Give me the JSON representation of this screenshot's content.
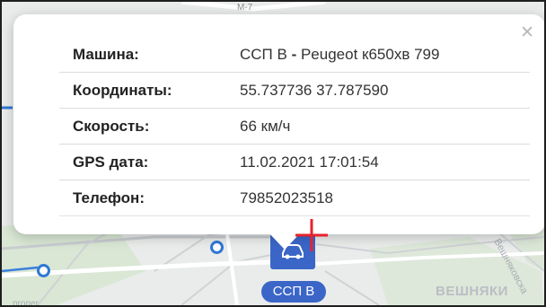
{
  "popup": {
    "close_icon": "close-icon",
    "rows": [
      {
        "label": "Машина:",
        "value_main": "ССП В",
        "value_sep": " - ",
        "value_rest": "Peugeot к650хв 799"
      },
      {
        "label": "Координаты:",
        "value": "55.737736 37.787590"
      },
      {
        "label": "Скорость:",
        "value": "66 км/ч"
      },
      {
        "label": "GPS дата:",
        "value": "11.02.2021 17:01:54"
      },
      {
        "label": "Телефон:",
        "value": "79852023518"
      }
    ]
  },
  "map": {
    "vehicle_label": "ССП В",
    "vehicle_icon": "car-icon",
    "district_label": "ВЕШНЯКИ",
    "street_label": "Вешняковска",
    "top_road_label": "M-7",
    "edge_label": "proper",
    "marker_color": "#3b66c8",
    "metro_color": "#2f78d6",
    "cross_color": "#e8222d"
  }
}
